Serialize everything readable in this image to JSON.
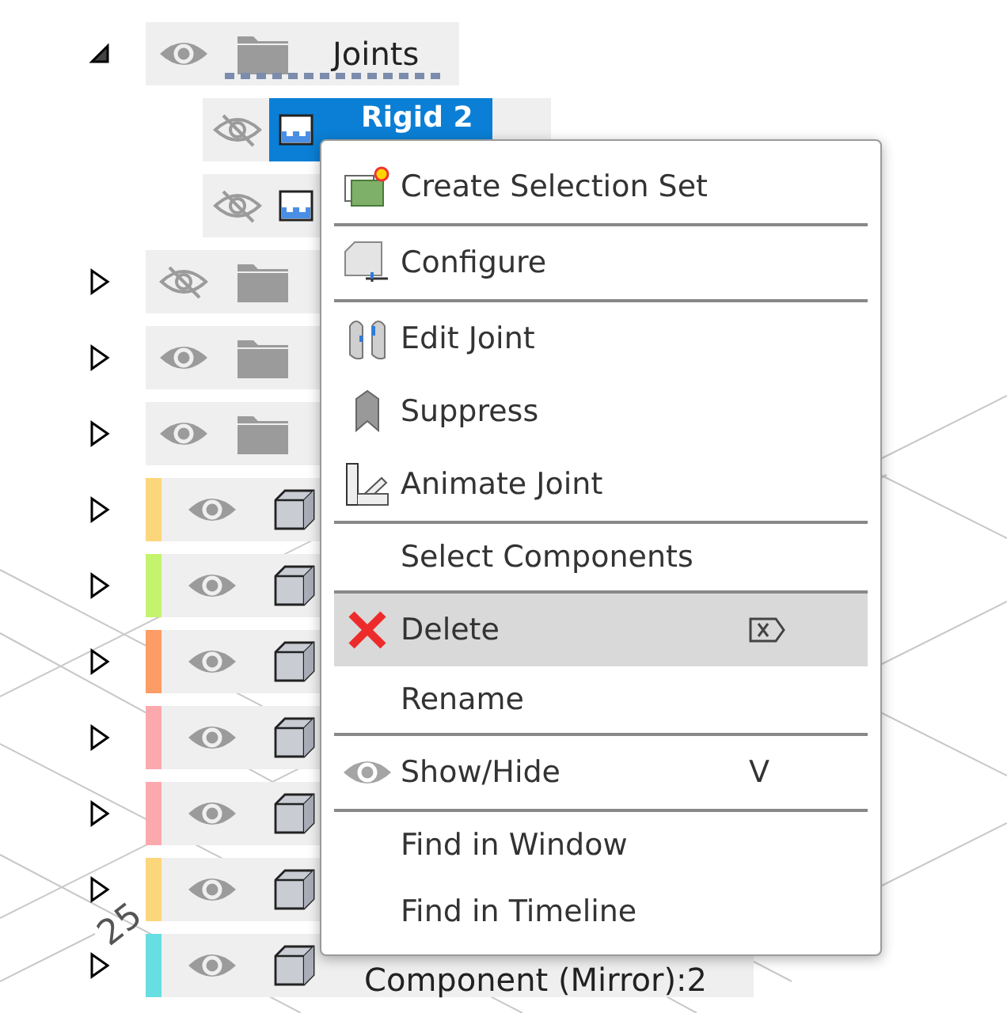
{
  "browser": {
    "items": [
      {
        "kind": "folder",
        "label": "Joints",
        "expanded": true,
        "visible": true,
        "selected": false,
        "dashed_underline": true,
        "children": [
          {
            "kind": "joint",
            "label": "Rigid 2",
            "visible": false,
            "selected": true
          },
          {
            "kind": "joint",
            "visible": false,
            "selected": false
          }
        ]
      },
      {
        "kind": "folder",
        "expanded": false,
        "visible": false,
        "selected": false
      },
      {
        "kind": "folder",
        "expanded": false,
        "visible": true,
        "selected": false
      },
      {
        "kind": "folder",
        "expanded": false,
        "visible": true,
        "selected": false
      },
      {
        "kind": "component",
        "expanded": false,
        "visible": true,
        "selected": false,
        "color": "#fcd67a"
      },
      {
        "kind": "component",
        "expanded": false,
        "visible": true,
        "selected": false,
        "color": "#c4f36e"
      },
      {
        "kind": "component",
        "expanded": false,
        "visible": true,
        "selected": false,
        "color": "#fd9c64"
      },
      {
        "kind": "component",
        "expanded": false,
        "visible": true,
        "selected": false,
        "color": "#fca9ae"
      },
      {
        "kind": "component",
        "expanded": false,
        "visible": true,
        "selected": false,
        "color": "#fca9ae"
      },
      {
        "kind": "component",
        "expanded": false,
        "visible": true,
        "selected": false,
        "color": "#fcd67a"
      },
      {
        "kind": "component",
        "label": "Component (Mirror):2",
        "expanded": false,
        "visible": true,
        "selected": false,
        "color": "#66dee2"
      }
    ]
  },
  "viewport": {
    "axis_label": "25"
  },
  "context_menu": {
    "items": [
      {
        "kind": "item",
        "label": "Create Selection Set",
        "selected": false
      },
      {
        "kind": "separator"
      },
      {
        "kind": "item",
        "label": "Configure",
        "selected": false
      },
      {
        "kind": "separator"
      },
      {
        "kind": "item",
        "label": "Edit Joint",
        "selected": false
      },
      {
        "kind": "item",
        "label": "Suppress",
        "selected": false
      },
      {
        "kind": "item",
        "label": "Animate Joint",
        "selected": false
      },
      {
        "kind": "separator"
      },
      {
        "kind": "item",
        "label": "Select Components",
        "selected": false
      },
      {
        "kind": "separator"
      },
      {
        "kind": "item",
        "label": "Delete",
        "selected": true
      },
      {
        "kind": "item",
        "label": "Rename",
        "selected": false
      },
      {
        "kind": "separator"
      },
      {
        "kind": "item",
        "label": "Show/Hide",
        "shortcut": "V",
        "selected": false
      },
      {
        "kind": "separator"
      },
      {
        "kind": "item",
        "label": "Find in Window",
        "selected": false
      },
      {
        "kind": "item",
        "label": "Find in Timeline",
        "selected": false
      }
    ]
  }
}
